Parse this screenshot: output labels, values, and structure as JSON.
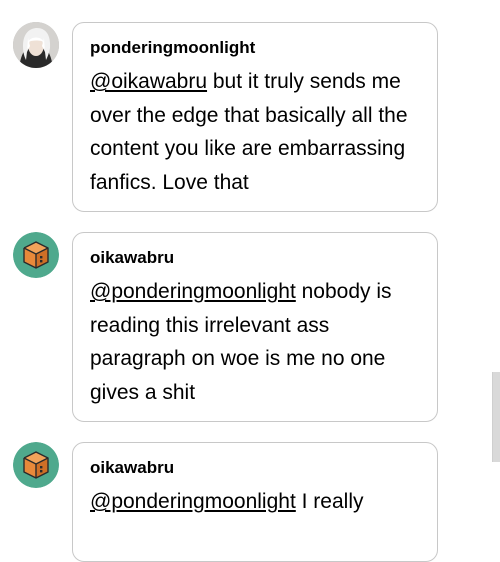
{
  "replies": [
    {
      "username": "ponderingmoonlight",
      "mention": "@oikawabru",
      "text": " but it truly sends me over the edge that basically all the content you like are embarrassing fanfics. Love that",
      "avatar_icon": "white-haired-character-avatar-icon"
    },
    {
      "username": "oikawabru",
      "mention": "@ponderingmoonlight",
      "text": " nobody is reading this irrelevant ass paragraph on woe is me no one gives a shit",
      "avatar_icon": "orange-cube-avatar-icon"
    },
    {
      "username": "oikawabru",
      "mention": "@ponderingmoonlight",
      "text": " I really",
      "avatar_icon": "orange-cube-avatar-icon"
    }
  ],
  "colors": {
    "bubble_border": "#c8c8c8",
    "cube_avatar_bg": "#4fa98d",
    "cube_orange": "#e8893a",
    "text": "#000000"
  }
}
